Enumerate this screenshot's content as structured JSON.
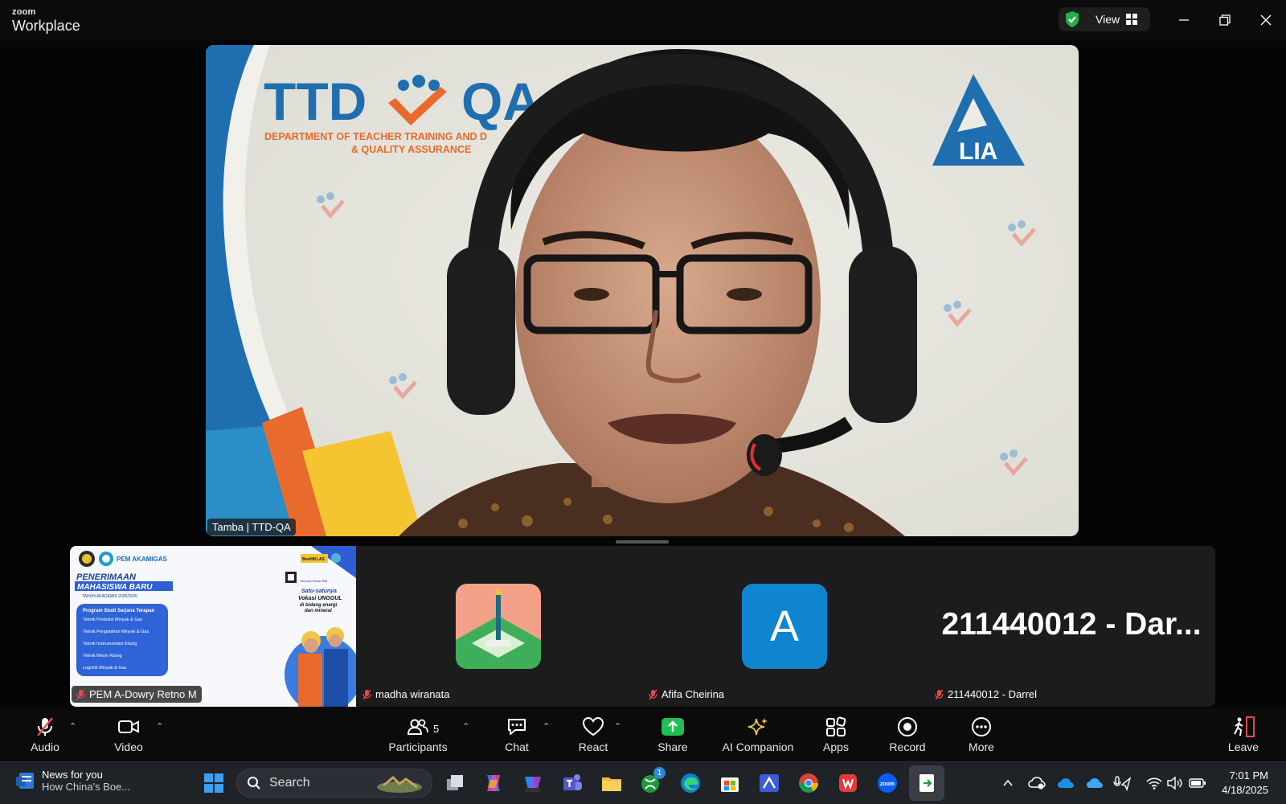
{
  "window": {
    "brand_small": "zoom",
    "brand_big": "Workplace",
    "view_label": "View"
  },
  "main_video": {
    "speaker_name": "Tamba | TTD-QA",
    "background_logo_text": "TTD",
    "background_logo_text2": "QA",
    "background_dept_line1": "DEPARTMENT OF TEACHER TRAINING  AND D",
    "background_dept_line2": "& QUALITY ASSURANCE",
    "lia_logo": "LIA"
  },
  "participants_strip": [
    {
      "name": "PEM A-Dowry Retno M",
      "muted": true,
      "poster": {
        "org": "PEM AKAMIGAS",
        "title1": "PENERIMAAN",
        "title2": "MAHASISWA BARU",
        "year": "TAHUN AKADEMIK 2025/2026",
        "program_header": "Program Studi Sarjana Terapan",
        "programs": [
          "Teknik Produksi Minyak & Gas",
          "Teknik Pengolahan Minyak & Gas",
          "Teknik Instrumentasi Kilang",
          "Teknik Mesin Kilang",
          "Logistik Minyak & Gas"
        ],
        "tag": "BeeHIKLAS",
        "tagline1": "Satu-satunya",
        "tagline2": "Vokasi UNGGUL",
        "tagline3": "di bidang energi",
        "tagline4": "dan mineral"
      }
    },
    {
      "name": "madha wiranata",
      "muted": true
    },
    {
      "name": "Afifa Cheirina",
      "muted": true,
      "avatar_letter": "A"
    },
    {
      "name": "211440012 - Darrel",
      "muted": true,
      "display_text": "211440012  -  Dar..."
    }
  ],
  "toolbar": {
    "audio": "Audio",
    "video": "Video",
    "participants": "Participants",
    "participants_count": "5",
    "chat": "Chat",
    "react": "React",
    "share": "Share",
    "ai_companion": "AI Companion",
    "apps": "Apps",
    "record": "Record",
    "more": "More",
    "leave": "Leave"
  },
  "taskbar": {
    "news_title": "News for you",
    "news_sub": "How China's Boe...",
    "search_placeholder": "Search",
    "time": "7:01 PM",
    "date": "4/18/2025",
    "xbox_badge": "1"
  },
  "colors": {
    "share_green": "#1fbf53",
    "ai_yellow": "#f3c84b",
    "zoom_blue": "#0b5cff",
    "avatar_blue": "#0f85d0"
  }
}
